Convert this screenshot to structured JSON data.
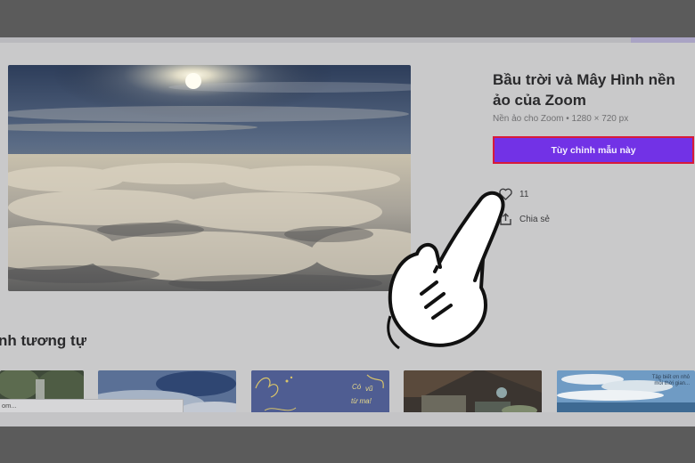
{
  "template": {
    "title": "Bầu trời và Mây Hình nền ảo của Zoom",
    "subtitle": "Nền ảo cho Zoom • 1280 × 720 px",
    "cta_label": "Tùy chỉnh mẫu này",
    "likes": "11",
    "share_label": "Chia sẻ"
  },
  "similar": {
    "heading": "nh tương tự",
    "thumb3_text_a": "Có",
    "thumb3_text_b": "vũ",
    "thumb3_text_c": "từ ma!",
    "thumb5_caption": "Tập biết ơn nhỏ mỗi thời gian..."
  },
  "tooltip_text": "om...",
  "colors": {
    "cta": "#7232e6",
    "cta_border": "#d81a3a",
    "overlay": "#c9c9ca"
  },
  "icons": [
    "heart-icon",
    "share-icon",
    "pointing-hand-icon"
  ]
}
